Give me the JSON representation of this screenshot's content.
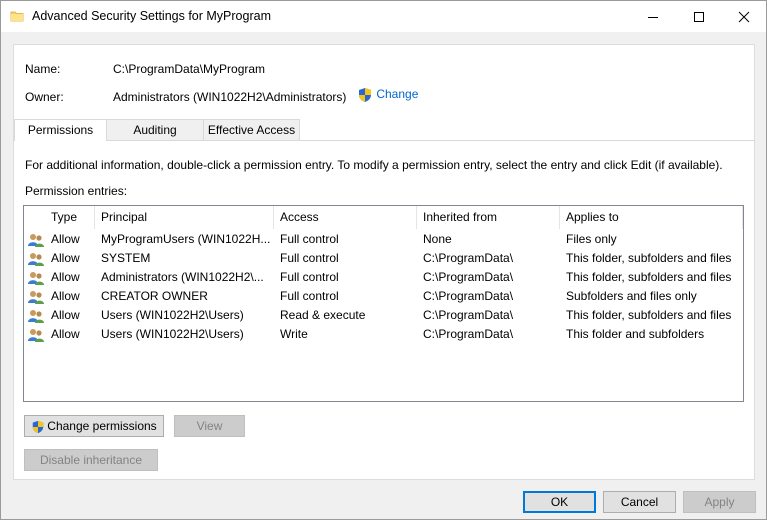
{
  "window": {
    "title": "Advanced Security Settings for MyProgram"
  },
  "details": {
    "name_label": "Name:",
    "name_value": "C:\\ProgramData\\MyProgram",
    "owner_label": "Owner:",
    "owner_value": "Administrators (WIN1022H2\\Administrators)",
    "change_link": "Change"
  },
  "tabs": [
    {
      "label": "Permissions",
      "active": true
    },
    {
      "label": "Auditing",
      "active": false
    },
    {
      "label": "Effective Access",
      "active": false
    }
  ],
  "info_text": "For additional information, double-click a permission entry. To modify a permission entry, select the entry and click Edit (if available).",
  "entries_label": "Permission entries:",
  "table": {
    "columns": [
      "Type",
      "Principal",
      "Access",
      "Inherited from",
      "Applies to"
    ],
    "rows": [
      [
        "Allow",
        "MyProgramUsers (WIN1022H...",
        "Full control",
        "None",
        "Files only"
      ],
      [
        "Allow",
        "SYSTEM",
        "Full control",
        "C:\\ProgramData\\",
        "This folder, subfolders and files"
      ],
      [
        "Allow",
        "Administrators (WIN1022H2\\...",
        "Full control",
        "C:\\ProgramData\\",
        "This folder, subfolders and files"
      ],
      [
        "Allow",
        "CREATOR OWNER",
        "Full control",
        "C:\\ProgramData\\",
        "Subfolders and files only"
      ],
      [
        "Allow",
        "Users (WIN1022H2\\Users)",
        "Read & execute",
        "C:\\ProgramData\\",
        "This folder, subfolders and files"
      ],
      [
        "Allow",
        "Users (WIN1022H2\\Users)",
        "Write",
        "C:\\ProgramData\\",
        "This folder and subfolders"
      ]
    ]
  },
  "buttons": {
    "change_permissions": "Change permissions",
    "view": "View",
    "disable_inheritance": "Disable inheritance",
    "ok": "OK",
    "cancel": "Cancel",
    "apply": "Apply"
  },
  "colors": {
    "link": "#0066cc",
    "default_button_border": "#0078d7"
  }
}
